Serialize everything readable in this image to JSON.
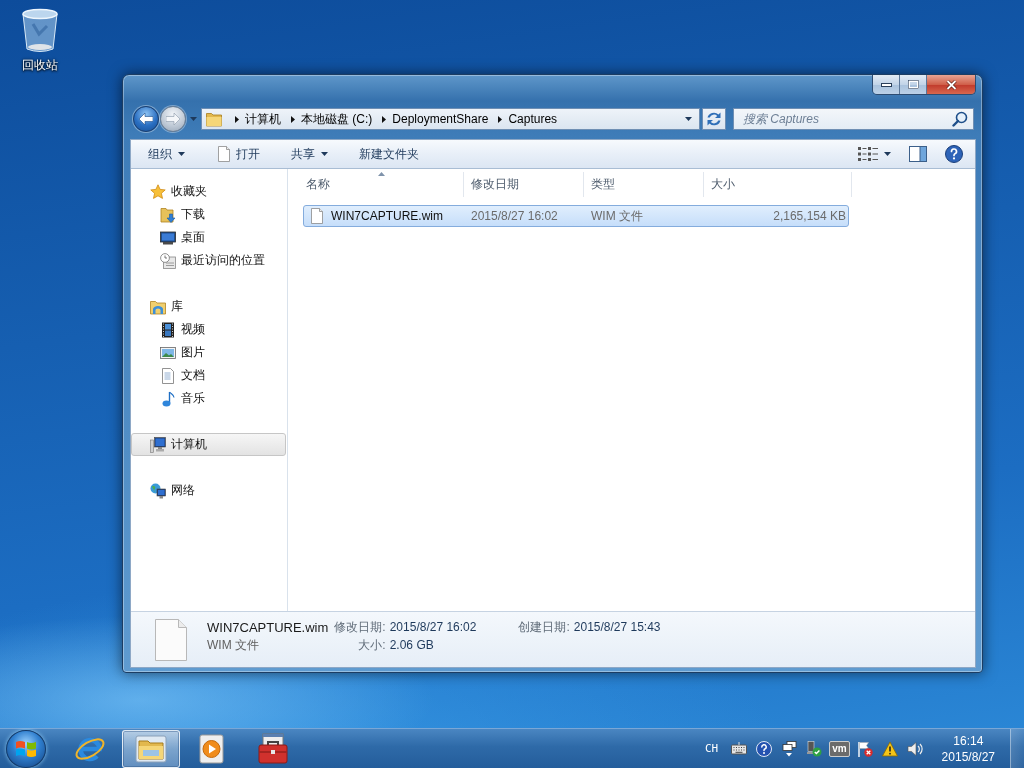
{
  "desktop": {
    "icons": [
      {
        "label": "回收站"
      }
    ]
  },
  "window": {
    "nav": {
      "buttons": [
        {
          "kind": "back",
          "disabled": false
        },
        {
          "kind": "forward",
          "disabled": true
        }
      ]
    },
    "address": {
      "path": [
        "计算机",
        "本地磁盘 (C:)",
        "DeploymentShare",
        "Captures"
      ]
    },
    "search": {
      "placeholder": "搜索 Captures"
    },
    "toolbar": {
      "items": [
        {
          "label": "组织",
          "kind": "menu"
        },
        {
          "label": "打开",
          "kind": "open"
        },
        {
          "label": "共享",
          "kind": "menu"
        },
        {
          "label": "新建文件夹",
          "kind": "plain"
        }
      ]
    },
    "sidebar": {
      "groups": [
        {
          "label": "收藏夹",
          "kind": "favorites",
          "selected": false,
          "children": [
            {
              "label": "下载",
              "kind": "downloads",
              "selected": false
            },
            {
              "label": "桌面",
              "kind": "desktop",
              "selected": false
            },
            {
              "label": "最近访问的位置",
              "kind": "recent",
              "selected": false
            }
          ]
        },
        {
          "label": "库",
          "kind": "libraries",
          "selected": false,
          "children": [
            {
              "label": "视频",
              "kind": "videos",
              "selected": false
            },
            {
              "label": "图片",
              "kind": "pictures",
              "selected": false
            },
            {
              "label": "文档",
              "kind": "documents",
              "selected": false
            },
            {
              "label": "音乐",
              "kind": "music",
              "selected": false
            }
          ]
        },
        {
          "label": "计算机",
          "kind": "computer",
          "selected": true
        },
        {
          "label": "网络",
          "kind": "network",
          "selected": false
        }
      ]
    },
    "file_list": {
      "columns": [
        {
          "label": "名称",
          "sorted": true
        },
        {
          "label": "修改日期",
          "sorted": false
        },
        {
          "label": "类型",
          "sorted": false
        },
        {
          "label": "大小",
          "sorted": false
        }
      ],
      "rows": [
        {
          "name": "WIN7CAPTURE.wim",
          "modified": "2015/8/27 16:02",
          "type": "WIM 文件",
          "size": "2,165,154 KB",
          "selected": true
        }
      ]
    },
    "details": {
      "name": "WIN7CAPTURE.wim",
      "type": "WIM 文件",
      "fields": [
        {
          "label": "修改日期:",
          "value": "2015/8/27 16:02"
        },
        {
          "label": "创建日期:",
          "value": "2015/8/27 15:43"
        },
        {
          "label": "大小:",
          "value": "2.06 GB"
        }
      ]
    }
  },
  "taskbar": {
    "apps": [
      {
        "kind": "browser",
        "selected": false
      },
      {
        "kind": "explorer",
        "selected": true
      },
      {
        "kind": "media-player",
        "selected": false
      },
      {
        "kind": "toolbox",
        "selected": false
      }
    ],
    "tray": {
      "language": "CH",
      "icons": [
        {
          "kind": "keyboard"
        },
        {
          "kind": "help"
        },
        {
          "kind": "windows"
        },
        {
          "kind": "network"
        },
        {
          "kind": "vm",
          "label": "vm"
        },
        {
          "kind": "action-center"
        },
        {
          "kind": "warning"
        },
        {
          "kind": "volume"
        }
      ],
      "time": "16:14",
      "date": "2015/8/27"
    }
  }
}
